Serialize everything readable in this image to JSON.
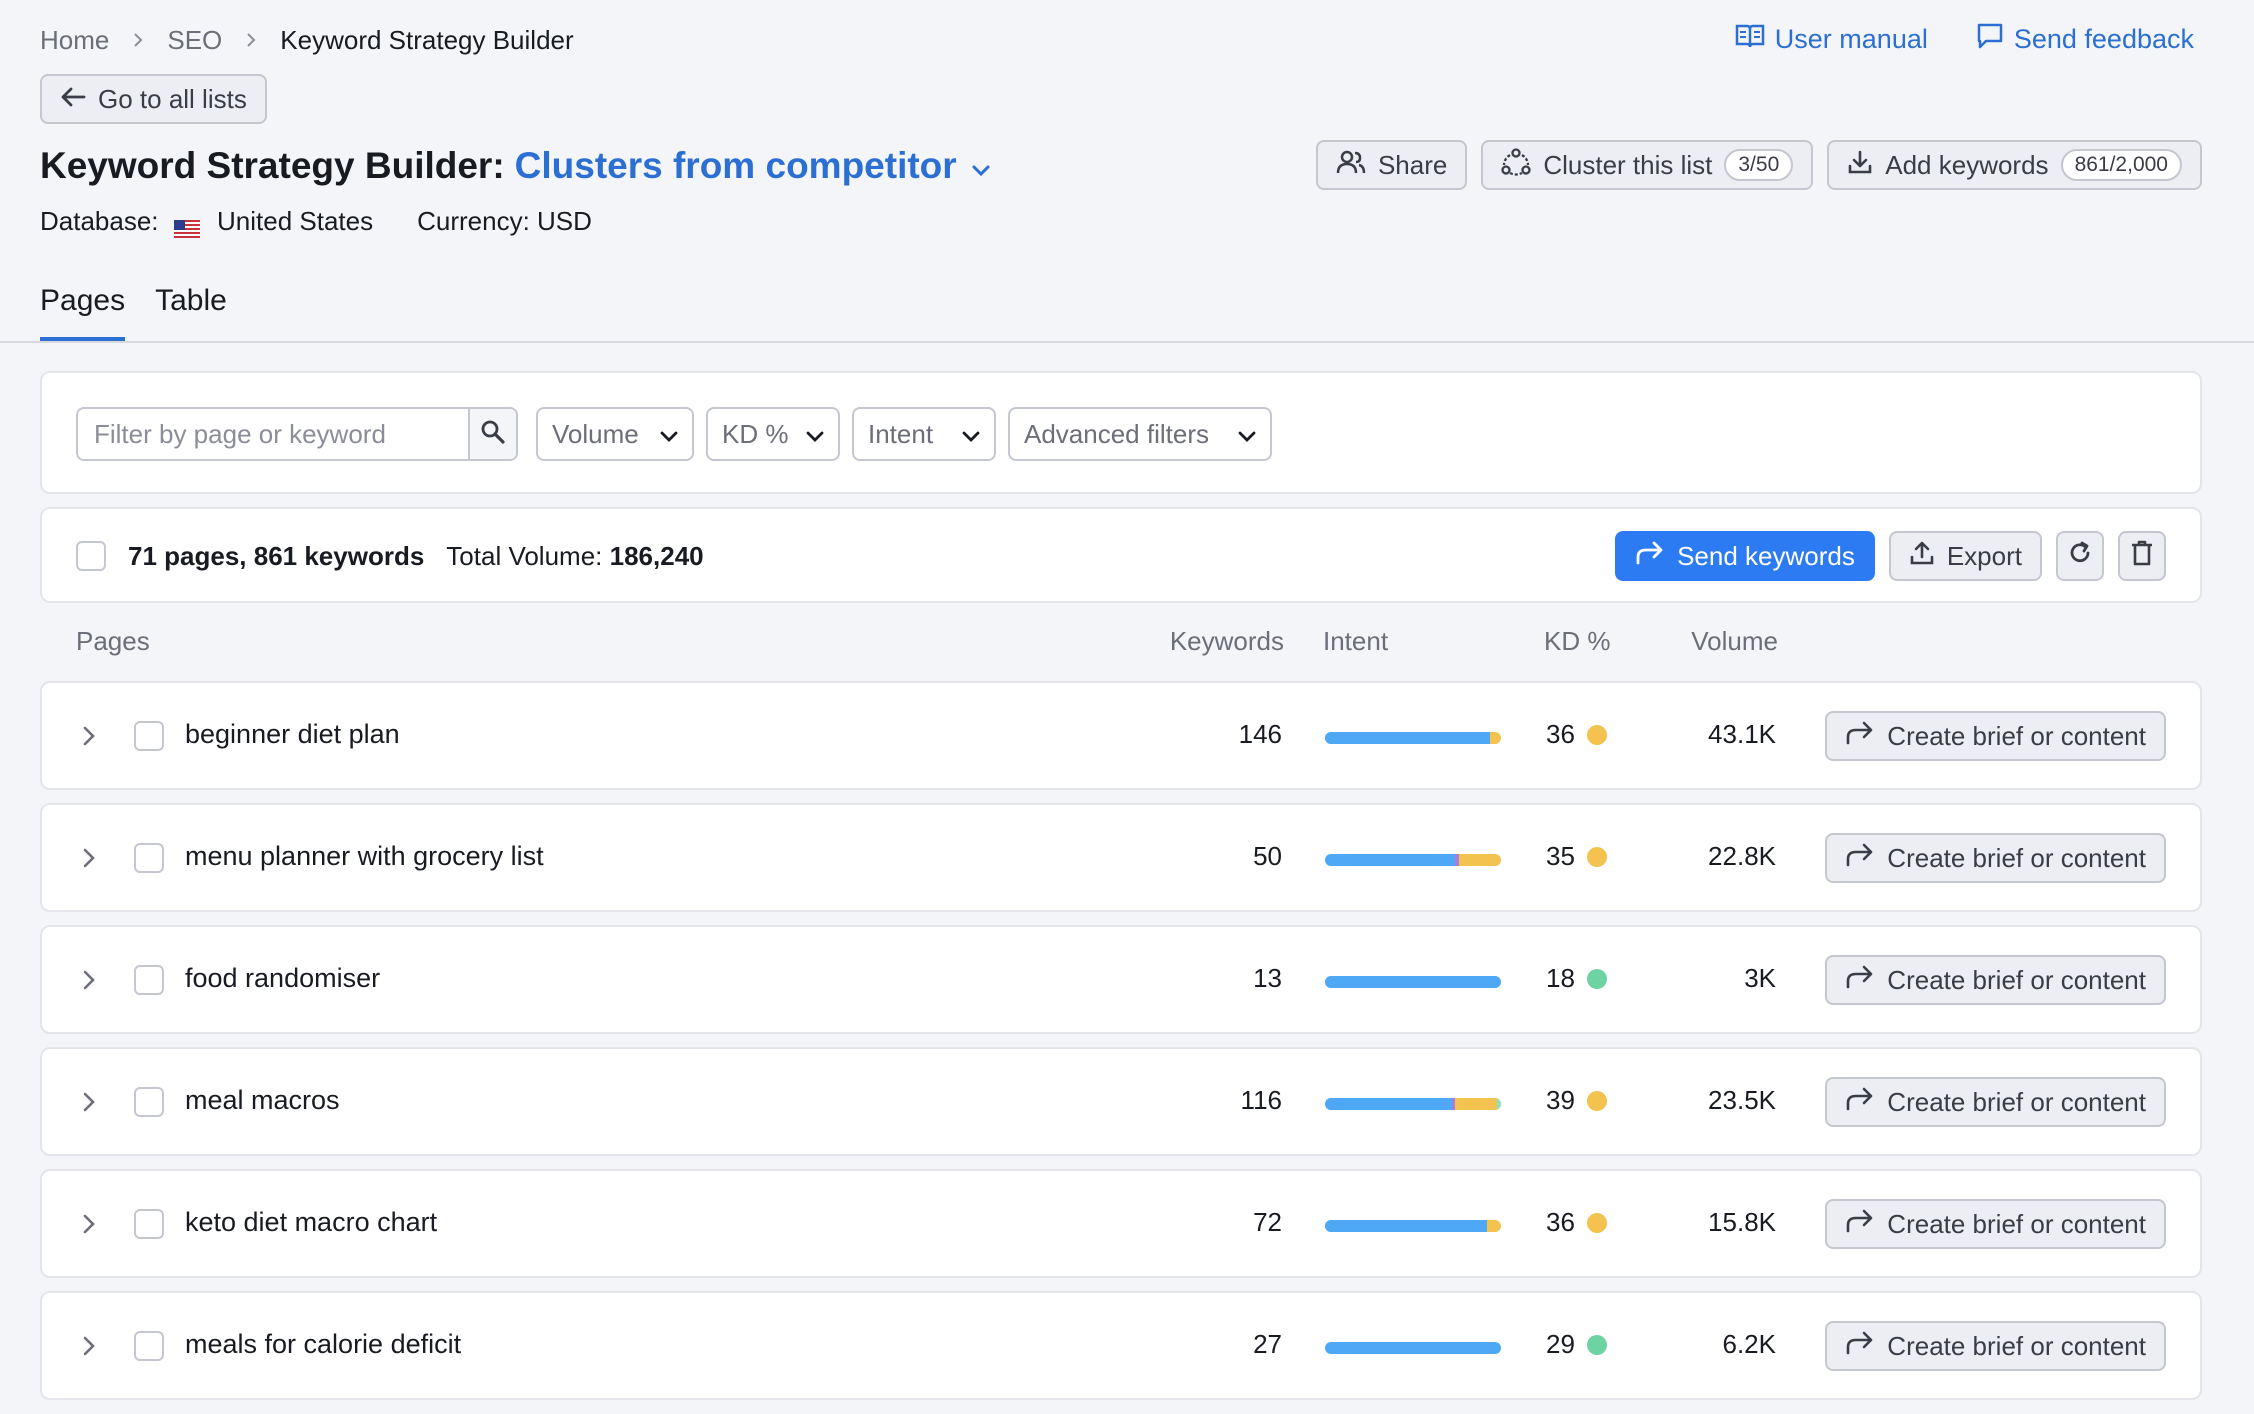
{
  "breadcrumb": [
    "Home",
    "SEO",
    "Keyword Strategy Builder"
  ],
  "top_links": {
    "manual": "User manual",
    "feedback": "Send feedback"
  },
  "back_label": "Go to all lists",
  "title": {
    "prefix": "Keyword Strategy Builder:",
    "list_name": "Clusters from competitor"
  },
  "meta": {
    "database_label": "Database:",
    "database_value": "United States",
    "currency": "Currency: USD"
  },
  "header_actions": {
    "share": "Share",
    "cluster": "Cluster this list",
    "cluster_count": "3/50",
    "add": "Add keywords",
    "add_count": "861/2,000"
  },
  "tabs": [
    "Pages",
    "Table"
  ],
  "filters": {
    "search_placeholder": "Filter by page or keyword",
    "volume": "Volume",
    "kd": "KD %",
    "intent": "Intent",
    "advanced": "Advanced filters"
  },
  "summary": {
    "counts": "71 pages, 861 keywords",
    "total_label": "Total Volume:",
    "total_value": "186,240",
    "send": "Send keywords",
    "export": "Export"
  },
  "columns": {
    "pages": "Pages",
    "keywords": "Keywords",
    "intent": "Intent",
    "kd": "KD %",
    "volume": "Volume"
  },
  "colors": {
    "accent": "#2b6fd3",
    "send_button": "#2c7bf2",
    "intent_informational": "#4ea8f5",
    "intent_navigational": "#a77ee0",
    "intent_commercial": "#f3c24f",
    "intent_transactional": "#8fe0c0",
    "kd_easy": "#6dd3a3",
    "kd_possible": "#f3c24f"
  },
  "brief_label": "Create brief or content",
  "rows": [
    {
      "page": "beginner diet plan",
      "keywords": "146",
      "kd": "36",
      "kd_level": "possible",
      "volume": "43.1K",
      "intent": {
        "informational": 0.94,
        "navigational": 0.0,
        "commercial": 0.06,
        "transactional": 0.0
      }
    },
    {
      "page": "menu planner with grocery list",
      "keywords": "50",
      "kd": "35",
      "kd_level": "possible",
      "volume": "22.8K",
      "intent": {
        "informational": 0.74,
        "navigational": 0.02,
        "commercial": 0.24,
        "transactional": 0.0
      }
    },
    {
      "page": "food randomiser",
      "keywords": "13",
      "kd": "18",
      "kd_level": "easy",
      "volume": "3K",
      "intent": {
        "informational": 1.0,
        "navigational": 0.0,
        "commercial": 0.0,
        "transactional": 0.0
      }
    },
    {
      "page": "meal macros",
      "keywords": "116",
      "kd": "39",
      "kd_level": "possible",
      "volume": "23.5K",
      "intent": {
        "informational": 0.72,
        "navigational": 0.02,
        "commercial": 0.24,
        "transactional": 0.02
      }
    },
    {
      "page": "keto diet macro chart",
      "keywords": "72",
      "kd": "36",
      "kd_level": "possible",
      "volume": "15.8K",
      "intent": {
        "informational": 0.92,
        "navigational": 0.0,
        "commercial": 0.08,
        "transactional": 0.0
      }
    },
    {
      "page": "meals for calorie deficit",
      "keywords": "27",
      "kd": "29",
      "kd_level": "easy",
      "volume": "6.2K",
      "intent": {
        "informational": 1.0,
        "navigational": 0.0,
        "commercial": 0.0,
        "transactional": 0.0
      }
    }
  ]
}
